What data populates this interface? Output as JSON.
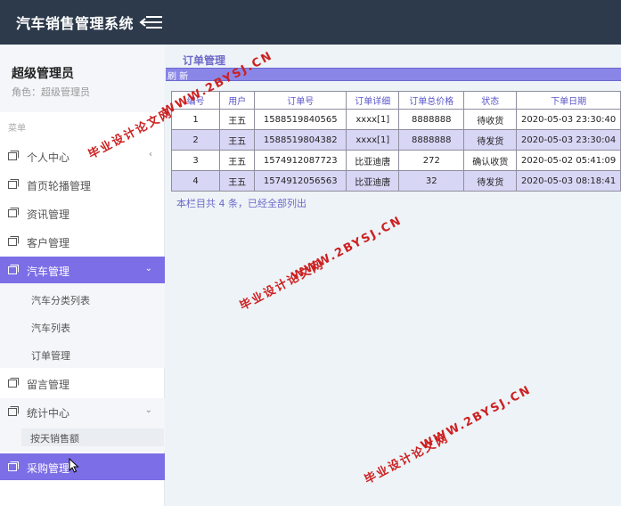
{
  "app": {
    "title": "汽车销售管理系统"
  },
  "user": {
    "name": "超级管理员",
    "role": "角色：超级管理员"
  },
  "sidebar": {
    "caption": "菜单",
    "items": [
      {
        "label": "个人中心",
        "arrow": "‹"
      },
      {
        "label": "首页轮播管理"
      },
      {
        "label": "资讯管理"
      },
      {
        "label": "客户管理"
      },
      {
        "label": "汽车管理",
        "arrow": "⌄"
      },
      {
        "label": "留言管理"
      },
      {
        "label": "统计中心",
        "arrow": "⌄"
      },
      {
        "label": "采购管理"
      }
    ],
    "car_sub": [
      "汽车分类列表",
      "汽车列表",
      "订单管理"
    ],
    "stat_sub": [
      "按天销售额"
    ]
  },
  "content": {
    "tab": "订单管理",
    "refresh": "刷 新",
    "table": {
      "headers": [
        "编号",
        "用户",
        "订单号",
        "订单详细",
        "订单总价格",
        "状态",
        "下单日期"
      ],
      "rows": [
        [
          "1",
          "王五",
          "1588519840565",
          "xxxx[1]",
          "8888888",
          "待收货",
          "2020-05-03 23:30:40"
        ],
        [
          "2",
          "王五",
          "1588519804382",
          "xxxx[1]",
          "8888888",
          "待发货",
          "2020-05-03 23:30:04"
        ],
        [
          "3",
          "王五",
          "1574912087723",
          "比亚迪唐",
          "272",
          "确认收货",
          "2020-05-02 05:41:09"
        ],
        [
          "4",
          "王五",
          "1574912056563",
          "比亚迪唐",
          "32",
          "待发货",
          "2020-05-03 08:18:41"
        ]
      ]
    },
    "summary": "本栏目共 4 条，已经全部列出"
  },
  "watermark": {
    "title": "毕业设计论文网",
    "url": "WWW.2BYSJ.CN"
  },
  "colors": {
    "topbar": "#2d3a4b",
    "accent": "#7c6ee6",
    "table_header_text": "#5a55c8"
  }
}
